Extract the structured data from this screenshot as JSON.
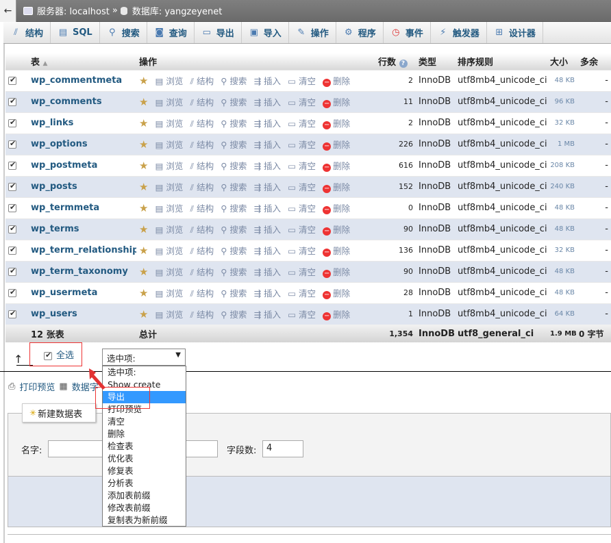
{
  "breadcrumb": {
    "back": "←",
    "server_label": "服务器: localhost",
    "separator": "»",
    "database_label": "数据库: yangzeyenet"
  },
  "tabs": [
    {
      "label": "结构",
      "icon": "structure-icon"
    },
    {
      "label": "SQL",
      "icon": "sql-icon"
    },
    {
      "label": "搜索",
      "icon": "search-icon"
    },
    {
      "label": "查询",
      "icon": "query-icon"
    },
    {
      "label": "导出",
      "icon": "export-icon"
    },
    {
      "label": "导入",
      "icon": "import-icon"
    },
    {
      "label": "操作",
      "icon": "wrench-icon"
    },
    {
      "label": "程序",
      "icon": "routines-icon"
    },
    {
      "label": "事件",
      "icon": "clock-icon"
    },
    {
      "label": "触发器",
      "icon": "triggers-icon"
    },
    {
      "label": "设计器",
      "icon": "designer-icon"
    }
  ],
  "table_headers": {
    "table": "表",
    "sort": "▲",
    "action": "操作",
    "rows": "行数",
    "type": "类型",
    "collation": "排序规则",
    "size": "大小",
    "overhead": "多余"
  },
  "actions": {
    "browse": "浏览",
    "structure": "结构",
    "search": "搜索",
    "insert": "插入",
    "empty": "清空",
    "drop": "删除"
  },
  "tables": [
    {
      "name": "wp_commentmeta",
      "rows": "2",
      "type": "InnoDB",
      "collation": "utf8mb4_unicode_ci",
      "size": "48 KB",
      "overhead": "-"
    },
    {
      "name": "wp_comments",
      "rows": "11",
      "type": "InnoDB",
      "collation": "utf8mb4_unicode_ci",
      "size": "96 KB",
      "overhead": "-"
    },
    {
      "name": "wp_links",
      "rows": "2",
      "type": "InnoDB",
      "collation": "utf8mb4_unicode_ci",
      "size": "32 KB",
      "overhead": "-"
    },
    {
      "name": "wp_options",
      "rows": "226",
      "type": "InnoDB",
      "collation": "utf8mb4_unicode_ci",
      "size": "1 MB",
      "overhead": "-"
    },
    {
      "name": "wp_postmeta",
      "rows": "616",
      "type": "InnoDB",
      "collation": "utf8mb4_unicode_ci",
      "size": "208 KB",
      "overhead": "-"
    },
    {
      "name": "wp_posts",
      "rows": "152",
      "type": "InnoDB",
      "collation": "utf8mb4_unicode_ci",
      "size": "240 KB",
      "overhead": "-"
    },
    {
      "name": "wp_termmeta",
      "rows": "0",
      "type": "InnoDB",
      "collation": "utf8mb4_unicode_ci",
      "size": "48 KB",
      "overhead": "-"
    },
    {
      "name": "wp_terms",
      "rows": "90",
      "type": "InnoDB",
      "collation": "utf8mb4_unicode_ci",
      "size": "48 KB",
      "overhead": "-"
    },
    {
      "name": "wp_term_relationships",
      "rows": "136",
      "type": "InnoDB",
      "collation": "utf8mb4_unicode_ci",
      "size": "32 KB",
      "overhead": "-"
    },
    {
      "name": "wp_term_taxonomy",
      "rows": "90",
      "type": "InnoDB",
      "collation": "utf8mb4_unicode_ci",
      "size": "48 KB",
      "overhead": "-"
    },
    {
      "name": "wp_usermeta",
      "rows": "28",
      "type": "InnoDB",
      "collation": "utf8mb4_unicode_ci",
      "size": "48 KB",
      "overhead": "-"
    },
    {
      "name": "wp_users",
      "rows": "1",
      "type": "InnoDB",
      "collation": "utf8mb4_unicode_ci",
      "size": "64 KB",
      "overhead": "-"
    }
  ],
  "totals": {
    "count": "12 张表",
    "label": "总计",
    "rows": "1,354",
    "type": "InnoDB",
    "collation": "utf8_general_ci",
    "size": "1.9 MB",
    "overhead": "0 字节"
  },
  "bulk": {
    "select_all": "全选",
    "select_placeholder": "选中项:",
    "options": [
      "选中项:",
      "Show create",
      "导出",
      "打印预览",
      "清空",
      "删除",
      "检查表",
      "优化表",
      "修复表",
      "分析表",
      "添加表前缀",
      "修改表前缀",
      "复制表为新前缀"
    ],
    "selected_option": "导出"
  },
  "print": {
    "print_view": "打印预览",
    "data_dict": "数据字"
  },
  "create_table": {
    "button": "新建数据表",
    "name_label": "名字:",
    "name_value": "",
    "fields_label": "字段数:",
    "fields_value": "4"
  },
  "colors": {
    "link": "#235a81",
    "row_alt": "#dfe5f0",
    "highlight": "#3399ff",
    "annotation": "#e33333"
  }
}
